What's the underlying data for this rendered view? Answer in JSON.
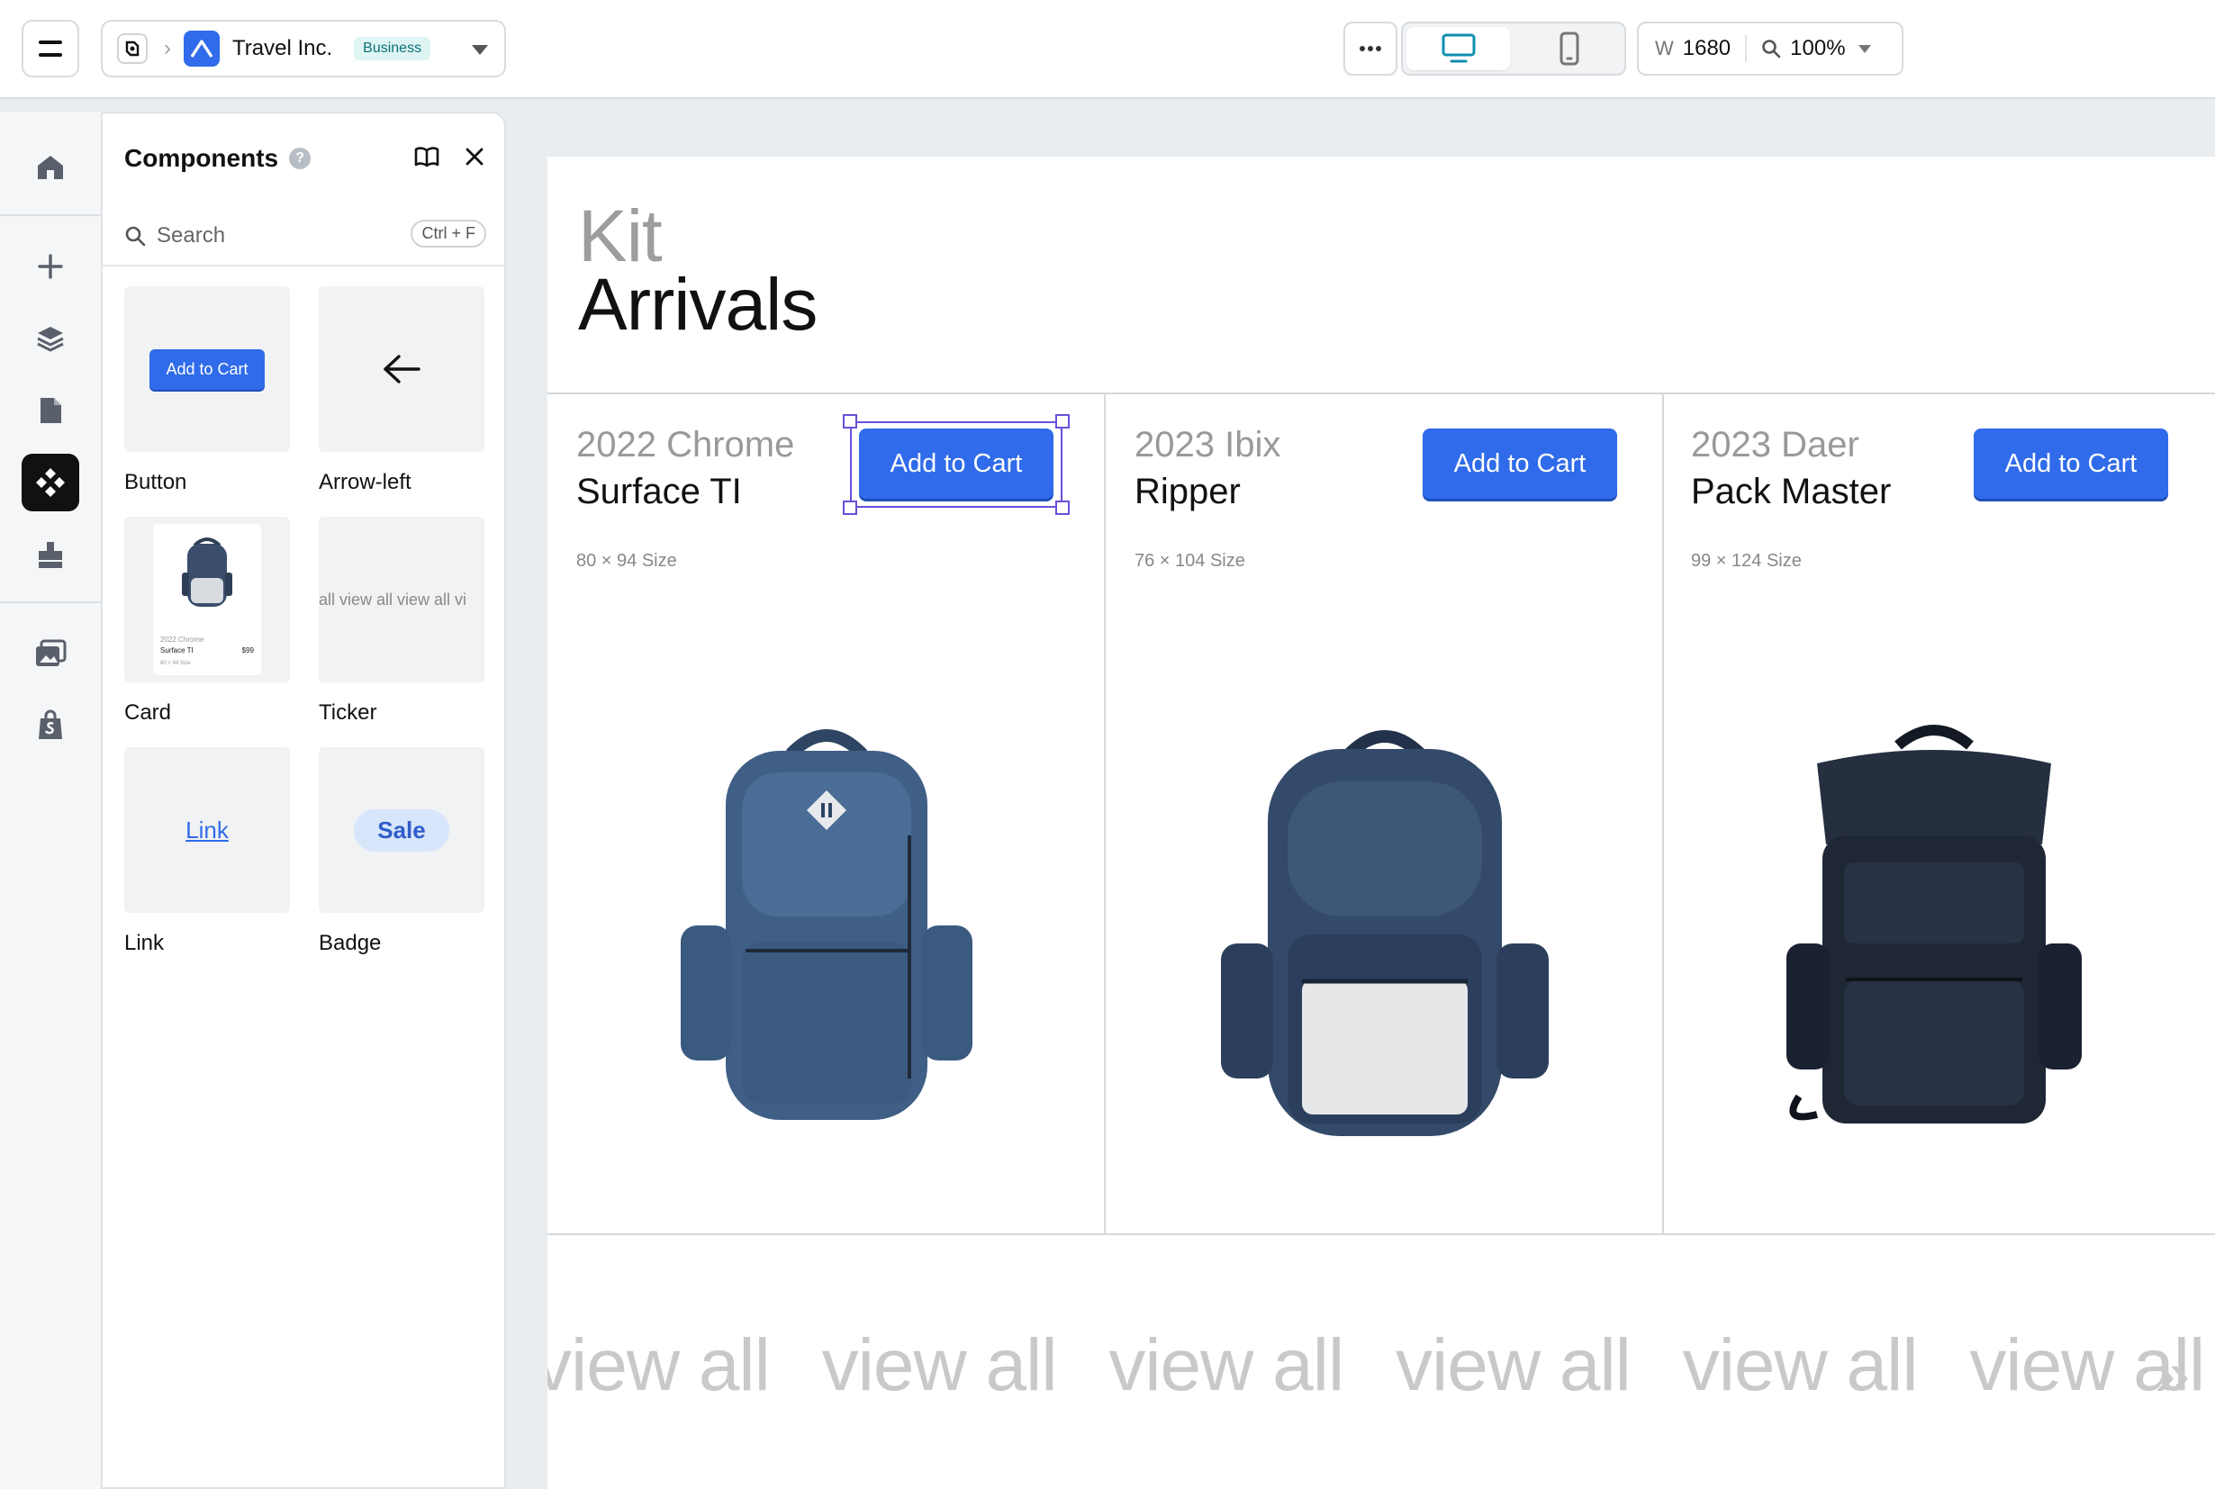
{
  "topbar": {
    "brand_name": "Travel Inc.",
    "plan_badge": "Business",
    "width_label": "W",
    "width_value": "1680",
    "zoom_value": "100%"
  },
  "panel": {
    "title": "Components",
    "search_placeholder": "Search",
    "search_shortcut": "Ctrl + F",
    "components": [
      {
        "label": "Button",
        "preview_text": "Add to Cart"
      },
      {
        "label": "Arrow-left"
      },
      {
        "label": "Card",
        "preview_year": "2022 Chrome",
        "preview_name": "Surface TI",
        "preview_price": "$99",
        "preview_size": "80 × 94 Size"
      },
      {
        "label": "Ticker",
        "preview_text": "all  view all  view all  vi"
      },
      {
        "label": "Link",
        "preview_text": "Link"
      },
      {
        "label": "Badge",
        "preview_text": "Sale"
      }
    ]
  },
  "canvas": {
    "hero_line1": "Kit",
    "hero_line2": "Arrivals",
    "products": [
      {
        "year": "2022 Chrome",
        "name": "Surface TI",
        "size": "80 × 94 Size",
        "cart_label": "Add to Cart"
      },
      {
        "year": "2023 Ibix",
        "name": "Ripper",
        "size": "76 × 104 Size",
        "cart_label": "Add to Cart"
      },
      {
        "year": "2023 Daer",
        "name": "Pack Master",
        "size": "99 × 124 Size",
        "cart_label": "Add to Cart"
      }
    ],
    "ticker_items": [
      "view all",
      "view all",
      "view all",
      "view all",
      "view all",
      "view all"
    ],
    "ticker_arrow": "»"
  },
  "colors": {
    "accent": "#2f6bea",
    "selection": "#6b4fd8",
    "bag_blue": "#3f5f86",
    "bag_navy": "#2e3e55",
    "bag_dark": "#1f2735"
  },
  "icons": [
    "menu-icon",
    "project-icon",
    "chevron-right-icon",
    "brand-logo-icon",
    "caret-down-icon",
    "more-icon",
    "desktop-icon",
    "mobile-icon",
    "search-icon",
    "home-icon",
    "plus-icon",
    "layers-icon",
    "page-icon",
    "components-icon",
    "plugin-icon",
    "media-icon",
    "shop-icon",
    "help-icon",
    "book-icon",
    "close-icon",
    "arrow-left-icon"
  ]
}
